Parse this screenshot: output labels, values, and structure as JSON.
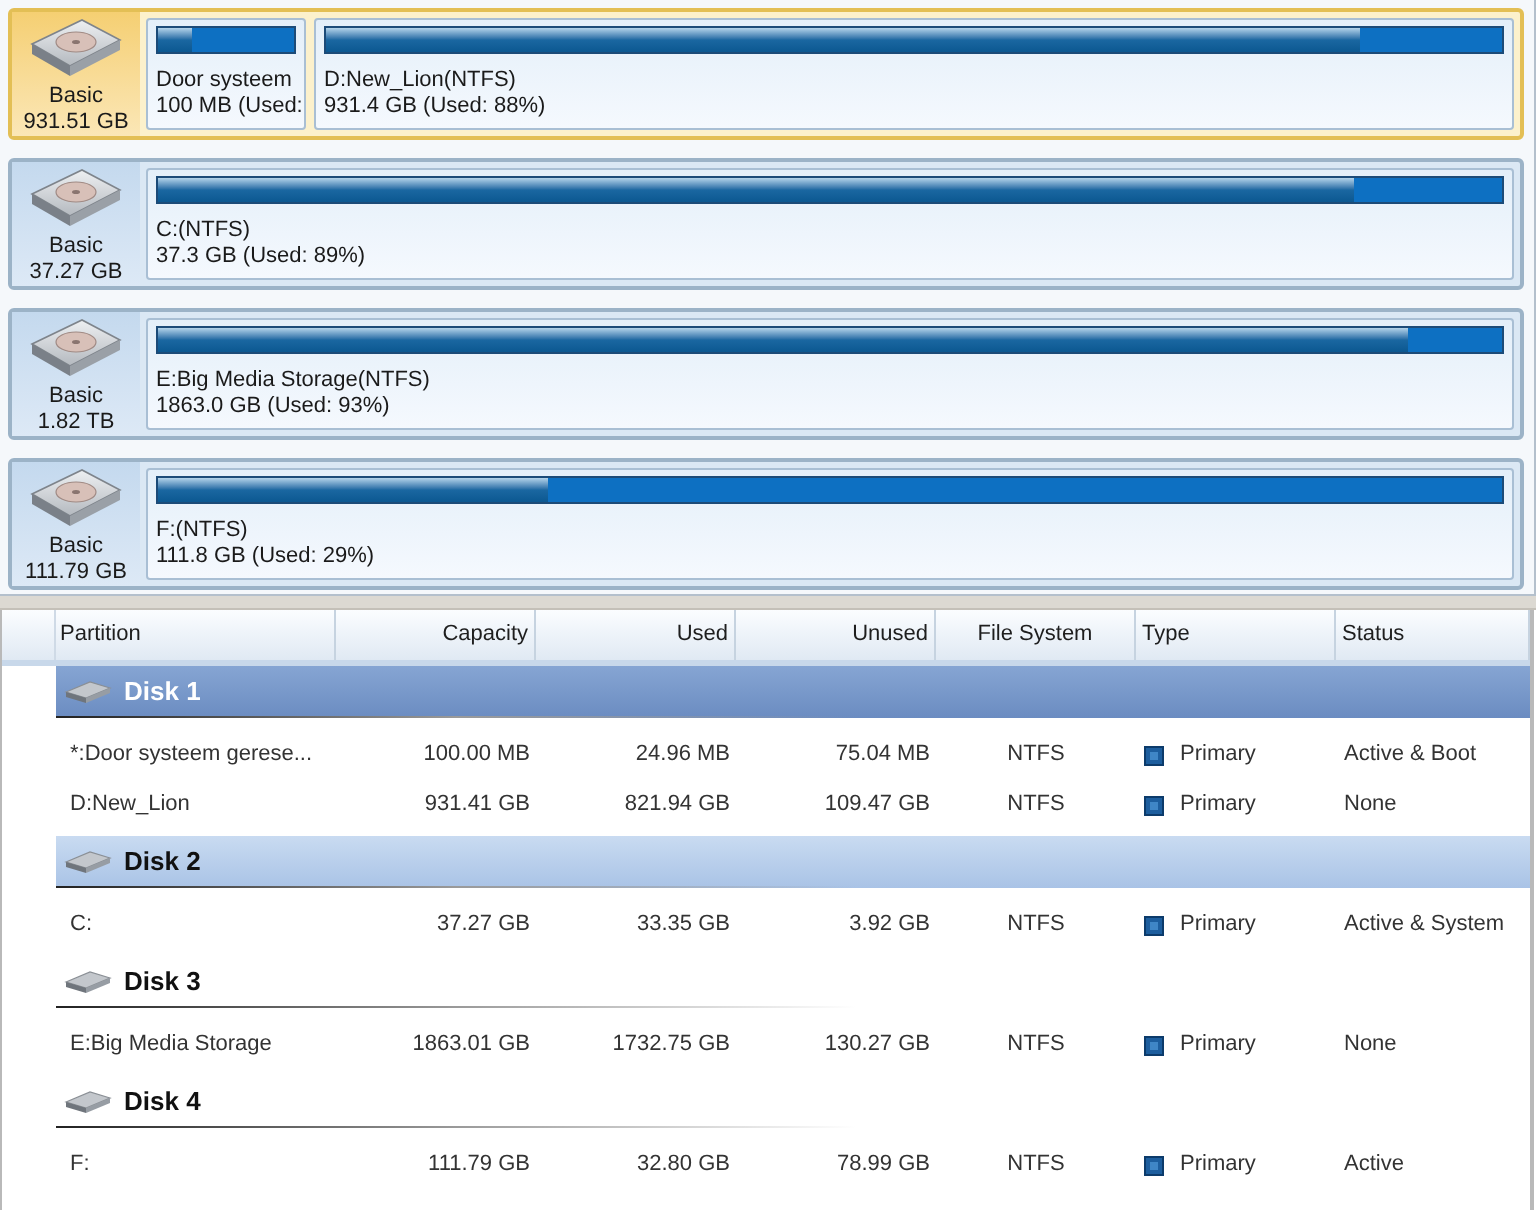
{
  "disk_map": [
    {
      "disk_type": "Basic",
      "size": "931.51 GB",
      "selected": true,
      "partitions": [
        {
          "name": "Door systeem",
          "detail": "100 MB (Used:",
          "level": 0.25
        },
        {
          "name": "D:New_Lion(NTFS)",
          "detail": "931.4 GB (Used: 88%)",
          "level": 0.88
        }
      ]
    },
    {
      "disk_type": "Basic",
      "size": "37.27 GB",
      "selected": false,
      "partitions": [
        {
          "name": "C:(NTFS)",
          "detail": "37.3 GB (Used: 89%)",
          "level": 0.89
        }
      ]
    },
    {
      "disk_type": "Basic",
      "size": "1.82 TB",
      "selected": false,
      "partitions": [
        {
          "name": "E:Big Media Storage(NTFS)",
          "detail": "1863.0 GB (Used: 93%)",
          "level": 0.93
        }
      ]
    },
    {
      "disk_type": "Basic",
      "size": "111.79 GB",
      "selected": false,
      "partitions": [
        {
          "name": "F:(NTFS)",
          "detail": "111.8 GB (Used: 29%)",
          "level": 0.29
        }
      ]
    }
  ],
  "partition_table": {
    "columns": [
      "Partition",
      "Capacity",
      "Used",
      "Unused",
      "File System",
      "Type",
      "Status"
    ],
    "disks": [
      {
        "name": "Disk 1",
        "selected": true,
        "highlighted": false,
        "partitions": [
          {
            "partition": "*:Door systeem gerese...",
            "capacity": "100.00 MB",
            "used": "24.96 MB",
            "unused": "75.04 MB",
            "file_system": "NTFS",
            "type": "Primary",
            "status": "Active & Boot"
          },
          {
            "partition": "D:New_Lion",
            "capacity": "931.41 GB",
            "used": "821.94 GB",
            "unused": "109.47 GB",
            "file_system": "NTFS",
            "type": "Primary",
            "status": "None"
          }
        ]
      },
      {
        "name": "Disk 2",
        "selected": false,
        "highlighted": true,
        "partitions": [
          {
            "partition": "C:",
            "capacity": "37.27 GB",
            "used": "33.35 GB",
            "unused": "3.92 GB",
            "file_system": "NTFS",
            "type": "Primary",
            "status": "Active & System"
          }
        ]
      },
      {
        "name": "Disk 3",
        "selected": false,
        "highlighted": false,
        "partitions": [
          {
            "partition": "E:Big Media Storage",
            "capacity": "1863.01 GB",
            "used": "1732.75 GB",
            "unused": "130.27 GB",
            "file_system": "NTFS",
            "type": "Primary",
            "status": "None"
          }
        ]
      },
      {
        "name": "Disk 4",
        "selected": false,
        "highlighted": false,
        "partitions": [
          {
            "partition": "F:",
            "capacity": "111.79 GB",
            "used": "32.80 GB",
            "unused": "78.99 GB",
            "file_system": "NTFS",
            "type": "Primary",
            "status": "Active"
          }
        ]
      }
    ]
  }
}
